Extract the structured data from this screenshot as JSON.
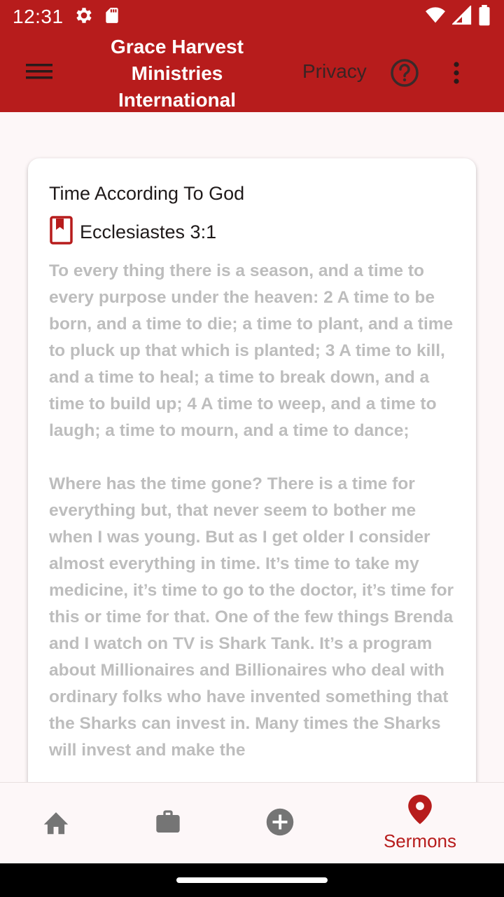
{
  "status_bar": {
    "time": "12:31",
    "left_icons": [
      "gear-icon",
      "sd-card-icon"
    ],
    "right_icons": [
      "wifi-icon",
      "cell-signal-icon",
      "battery-icon"
    ]
  },
  "app_bar": {
    "title": "Grace Harvest\nMinistries\nInternational",
    "privacy_label": "Privacy",
    "background_color": "#b71c1c"
  },
  "sermon": {
    "title": "Time According To God",
    "scripture_ref": "Ecclesiastes 3:1",
    "verse_text": "To every thing there is a season, and a time to every purpose under the heaven: 2 A time to be born, and a time to die; a time to plant, and a time to pluck up that which is planted; 3 A time to kill, and a time to heal; a time to break down, and a time to build up; 4 A time to weep, and a time to laugh; a time to mourn, and a time to dance;",
    "body_text": "Where has the time gone? There is a time for everything but, that never seem to bother me when I was young. But as I get older I consider almost everything in time. It’s time to take my medicine, it’s time to go to the doctor, it’s time for this or time for that. One of the few things Brenda and I watch on TV is Shark Tank. It’s a program about Millionaires and Billionaires who deal with ordinary folks who have invented something that the Sharks can invest in. Many times the Sharks will invest and make the"
  },
  "bottom_nav": {
    "items": [
      {
        "icon": "home-icon",
        "label": ""
      },
      {
        "icon": "briefcase-icon",
        "label": ""
      },
      {
        "icon": "add-circle-icon",
        "label": ""
      },
      {
        "icon": "location-pin-icon",
        "label": "Sermons",
        "active": true
      }
    ],
    "active_color": "#b71c1c",
    "inactive_color": "#757575"
  }
}
